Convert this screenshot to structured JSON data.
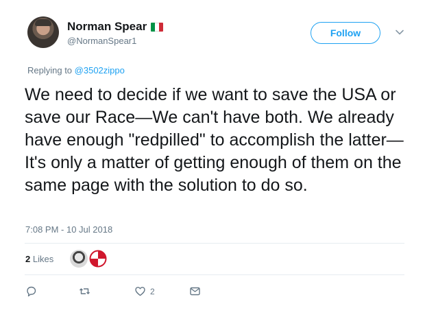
{
  "user": {
    "name": "Norman Spear",
    "handle": "@NormanSpear1",
    "flag_colors": [
      "#009246",
      "#ffffff",
      "#ce2b37"
    ]
  },
  "follow_label": "Follow",
  "reply": {
    "prefix": "Replying to ",
    "to": "@3502zippo"
  },
  "tweet_text": "We need to decide if we want to save the USA or save our Race—We can't have both. We already have enough \"redpilled\" to accomplish the latter—It's only a matter of getting enough of them on the same page with the solution to do so.",
  "timestamp": "7:08 PM - 10 Jul 2018",
  "likes": {
    "count": "2",
    "label": "Likes"
  },
  "actions": {
    "reply_icon": "reply-icon",
    "retweet_icon": "retweet-icon",
    "like_icon": "heart-icon",
    "like_count": "2",
    "dm_icon": "envelope-icon"
  },
  "colors": {
    "accent": "#1da1f2",
    "muted": "#657786",
    "text": "#14171a"
  }
}
